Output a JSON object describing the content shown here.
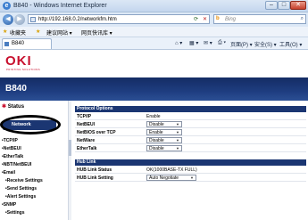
{
  "window": {
    "title": "B840 - Windows Internet Explorer",
    "min_glyph": "–",
    "max_glyph": "□",
    "close_glyph": "✕"
  },
  "address": {
    "url": "http://192.168.0.2/networkfm.htm",
    "search_placeholder": "Bing"
  },
  "favorites": {
    "favorites_label": "收藏夹",
    "suggested_label": "建议网站 ▾",
    "gallery_label": "网页快讯库 ▾"
  },
  "tab": {
    "label": "B840"
  },
  "commandbar": {
    "page_label": "页面(P) ▾",
    "safety_label": "安全(S) ▾",
    "tools_label": "工具(O) ▾"
  },
  "brand": {
    "logo": "OKI",
    "tagline": "PRINTING SOLUTIONS",
    "model": "B840"
  },
  "sidebar": {
    "status": "Status",
    "network": "Network",
    "items": [
      "•TCP/IP",
      "•NetBEUI",
      "•EtherTalk",
      "•NBT/NetBEUI",
      "•Email",
      "  •Receive Settings",
      "  •Send Settings",
      "  •Alert Settings",
      "•SNMP",
      "  •Settings"
    ]
  },
  "protocol": {
    "heading": "Protocol Options",
    "rows": [
      {
        "label": "TCP/IP",
        "value": "Enable"
      },
      {
        "label": "NetBEUI",
        "value": "Disable"
      },
      {
        "label": "NetBIOS over TCP",
        "value": "Enable"
      },
      {
        "label": "NetWare",
        "value": "Disable"
      },
      {
        "label": "EtherTalk",
        "value": "Disable"
      }
    ]
  },
  "hublink": {
    "heading": "Hub Link",
    "status_label": "HUB Link Status",
    "status_value": "OK(1000BASE-TX FULL)",
    "setting_label": "HUB Link Setting",
    "setting_value": "Auto Negotiate"
  },
  "colors": {
    "accent_navy": "#1b3672",
    "oki_red": "#c8102e"
  }
}
